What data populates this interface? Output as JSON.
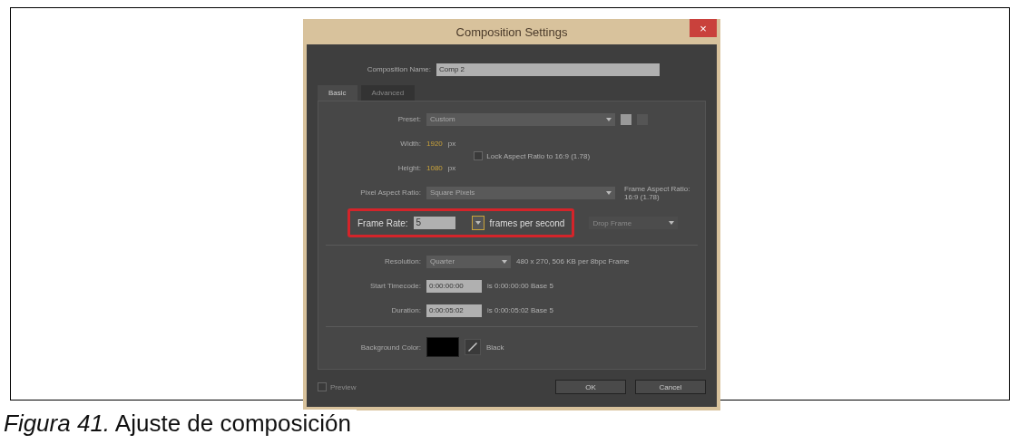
{
  "dialog": {
    "title": "Composition Settings",
    "close": "×",
    "name": {
      "label": "Composition Name:",
      "value": "Comp 2"
    },
    "tabs": [
      {
        "label": "Basic",
        "selected": true
      },
      {
        "label": "Advanced",
        "selected": false
      }
    ],
    "preset": {
      "label": "Preset:",
      "value": "Custom"
    },
    "width": {
      "label": "Width:",
      "value": "1920",
      "unit": "px"
    },
    "height": {
      "label": "Height:",
      "value": "1080",
      "unit": "px"
    },
    "lock_aspect": {
      "label": "Lock Aspect Ratio to 16:9 (1.78)",
      "checked": false
    },
    "pixel_aspect": {
      "label": "Pixel Aspect Ratio:",
      "value": "Square Pixels"
    },
    "frame_aspect": {
      "label": "Frame Aspect Ratio:",
      "value": "16:9 (1.78)"
    },
    "frame_rate": {
      "label": "Frame Rate:",
      "value": "5",
      "unit": "frames per second",
      "highlighted": true
    },
    "drop_frame": {
      "label": "Drop Frame",
      "disabled": true
    },
    "resolution": {
      "label": "Resolution:",
      "value": "Quarter",
      "info": "480 x 270, 506 KB per 8bpc Frame"
    },
    "start_timecode": {
      "label": "Start Timecode:",
      "value": "0:00:00:00",
      "info": "is 0:00:00:00  Base 5"
    },
    "duration": {
      "label": "Duration:",
      "value": "0:00:05:02",
      "info": "is 0:00:05:02  Base 5"
    },
    "background": {
      "label": "Background Color:",
      "color": "#000000",
      "name": "Black"
    },
    "preview": {
      "label": "Preview",
      "checked": false
    },
    "buttons": [
      "OK",
      "Cancel"
    ]
  },
  "caption": "*Figura 41.* Ajuste de composición"
}
